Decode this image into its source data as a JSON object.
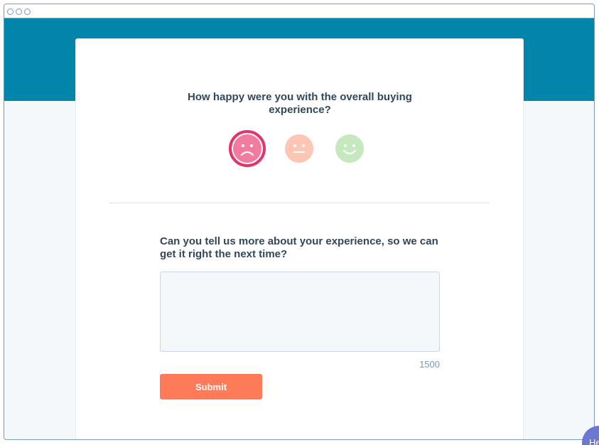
{
  "survey": {
    "question": "How happy were you with the overall buying experience?",
    "ratings": [
      {
        "name": "sad",
        "selected": true,
        "color": "#f27ba0",
        "ring_color": "#e2336b"
      },
      {
        "name": "neutral",
        "selected": false,
        "color": "#fcc5b4"
      },
      {
        "name": "happy",
        "selected": false,
        "color": "#c5e8bf"
      }
    ],
    "followup_question": "Can you tell us more about your experience, so we can get it right the next time?",
    "feedback": {
      "value": "",
      "char_limit": "1500"
    },
    "submit_label": "Submit"
  },
  "help": {
    "label": "He"
  },
  "colors": {
    "header": "#0185aa",
    "submit": "#ff7a59",
    "text": "#33475b",
    "muted": "#7c98b6"
  }
}
